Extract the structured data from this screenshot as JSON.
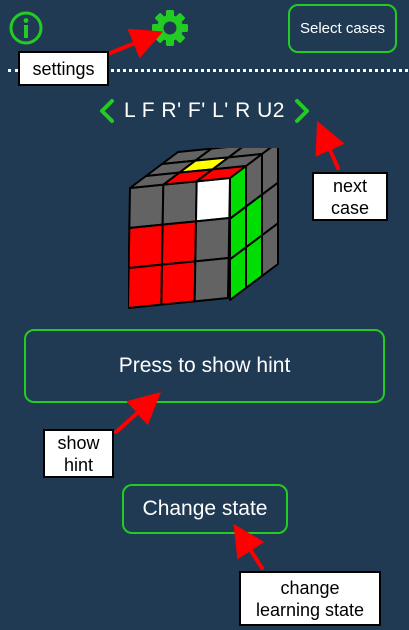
{
  "colors": {
    "background": "#1f3a52",
    "accent_green": "#22cc22",
    "cube_face_gray": "#636363",
    "cube_red": "#ff0000",
    "cube_green": "#00dd00",
    "cube_yellow": "#ffff00",
    "cube_white": "#ffffff",
    "annotation_arrow": "#ff0000"
  },
  "header": {
    "info_icon": "info-icon",
    "settings_icon": "gear-icon",
    "select_cases_label": "Select cases"
  },
  "algorithm": {
    "text": "L F R' F' L' R U2",
    "prev_icon": "chevron-left-icon",
    "next_icon": "chevron-right-icon"
  },
  "cube": {
    "top": [
      "gray",
      "gray",
      "gray",
      "gray",
      "yellow",
      "gray",
      "gray",
      "red",
      "red"
    ],
    "front": [
      "gray",
      "gray",
      "white",
      "red",
      "red",
      "gray",
      "red",
      "red",
      "gray"
    ],
    "right": [
      "green",
      "gray",
      "gray",
      "green",
      "green",
      "gray",
      "green",
      "green",
      "gray"
    ]
  },
  "buttons": {
    "hint_label": "Press to show hint",
    "change_state_label": "Change state"
  },
  "annotations": {
    "settings": "settings",
    "next_case": "next\ncase",
    "show_hint": "show\nhint",
    "change_learning_state": "change\nlearning state"
  }
}
